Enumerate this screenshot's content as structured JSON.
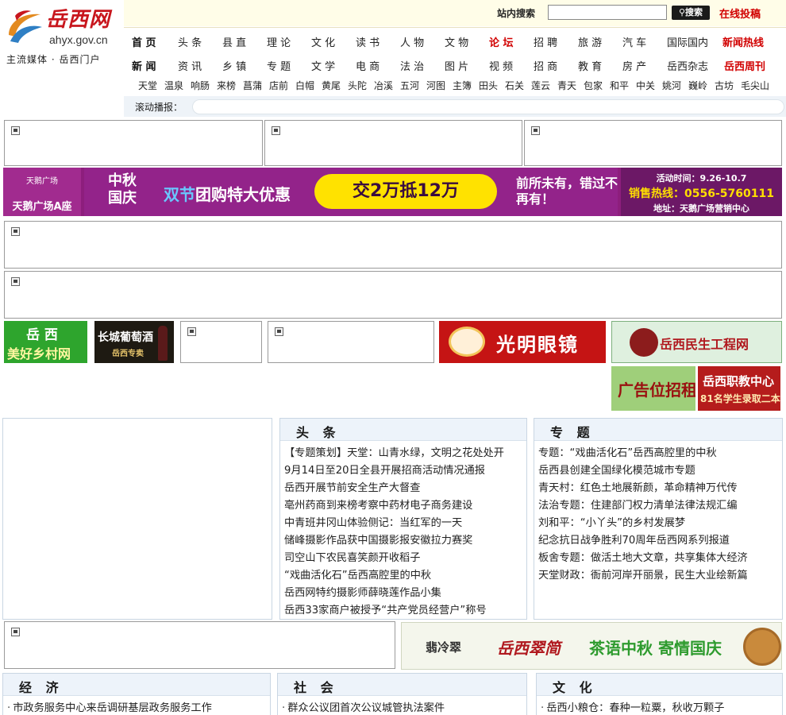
{
  "site": {
    "name": "岳西网",
    "domain": "ahyx.gov.cn",
    "slogan": "主流媒体 · 岳西门户"
  },
  "search": {
    "label": "站内搜索",
    "placeholder": "",
    "button": "搜索",
    "submit_link": "在线投稿"
  },
  "nav": {
    "row1": [
      "首 页",
      "头 条",
      "县 直",
      "理 论",
      "文 化",
      "读 书",
      "人 物",
      "文 物",
      "论 坛",
      "招 聘",
      "旅 游",
      "汽 车",
      "国际国内",
      "新闻热线"
    ],
    "row2": [
      "新 闻",
      "资 讯",
      "乡 镇",
      "专 题",
      "文 学",
      "电 商",
      "法 治",
      "图 片",
      "视 频",
      "招 商",
      "教 育",
      "房 产",
      "岳西杂志",
      "岳西周刊"
    ],
    "row3": [
      "天堂",
      "温泉",
      "响肠",
      "来榜",
      "菖蒲",
      "店前",
      "白帽",
      "黄尾",
      "头陀",
      "冶溪",
      "五河",
      "河图",
      "主簿",
      "田头",
      "石关",
      "莲云",
      "青天",
      "包家",
      "和平",
      "中关",
      "姚河",
      "巍岭",
      "古坊",
      "毛尖山"
    ]
  },
  "ticker": {
    "label": "滚动播报："
  },
  "banner": {
    "brand_small": "天鹅广场",
    "brand_main": "天鹅广场A座",
    "festival": "中秋国庆",
    "promo_prefix": "双节",
    "promo_rest": "团购特大优惠",
    "offer": "交2万抵12万",
    "slogan": "前所未有，错过不再有！",
    "time": "活动时间：9.26-10.7",
    "hotline": "销售热线：0556-5760111",
    "address": "地址：天鹅广场营销中心"
  },
  "ads": {
    "village_l1": "岳 西",
    "village_l2": "美好乡村网",
    "wine_l1": "长城葡萄酒",
    "wine_l2": "岳西专卖",
    "glasses": "光明眼镜",
    "livelihood": "岳西民生工程网",
    "rent": "广告位招租",
    "school_l1": "岳西职教中心",
    "school_l2": "81名学生录取二本",
    "mooncake_brand": "翡冷翠",
    "mooncake_store": "岳西翠简",
    "mooncake_slogan": "茶语中秋 寄情国庆"
  },
  "headlines": {
    "title": "头 条",
    "items": [
      "【专题策划】天堂：山青水绿，文明之花处处开",
      "9月14日至20日全县开展招商活动情况通报",
      "岳西开展节前安全生产大督查",
      "亳州药商到来榜考察中药材电子商务建设",
      "中青班井冈山体验侧记：当红军的一天",
      "储峰摄影作品获中国摄影报安徽拉力赛奖",
      "司空山下农民喜笑颜开收稻子",
      "“戏曲活化石”岳西高腔里的中秋",
      "岳西网特约摄影师薛晓莲作品小集",
      "岳西33家商户被授予“共产党员经营户”称号"
    ]
  },
  "topics": {
    "title": "专 题",
    "items": [
      "专题：“戏曲活化石”岳西高腔里的中秋",
      "岳西县创建全国绿化模范城市专题",
      "青天村：红色土地展新颜，革命精神万代传",
      "法治专题：住建部门权力清单法律法规汇编",
      "刘和平：“小丫头”的乡村发展梦",
      "纪念抗日战争胜利70周年岳西网系列报道",
      "板舍专题：做活土地大文章，共享集体大经济",
      "天堂财政：衙前河岸开丽景，民生大业绘新篇"
    ]
  },
  "economy": {
    "title": "经 济",
    "items": [
      "市政务服务中心来岳调研基层政务服务工作"
    ]
  },
  "society": {
    "title": "社 会",
    "items": [
      "群众公议团首次公议城管执法案件"
    ]
  },
  "culture": {
    "title": "文 化",
    "items": [
      "岳西小粮仓：春种一粒粟，秋收万颗子"
    ]
  },
  "colors": {
    "brand_red": "#c8161d",
    "nav_red": "#d10000",
    "banner_purple": "#8d1e7d",
    "panel_head": "#edf3fa"
  }
}
